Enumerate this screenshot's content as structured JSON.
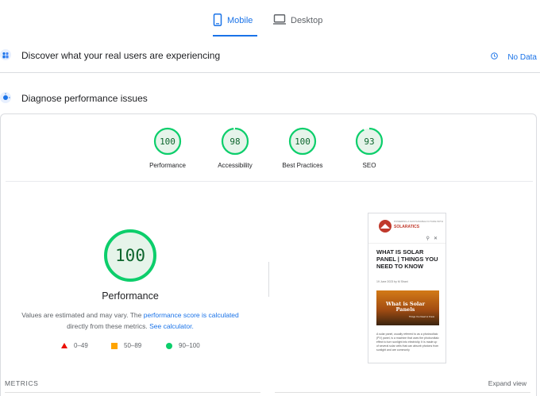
{
  "tabs": {
    "mobile": "Mobile",
    "desktop": "Desktop",
    "active": "mobile",
    "active_color": "#1a73e8"
  },
  "discover": {
    "title": "Discover what your real users are experiencing",
    "no_data": "No Data",
    "icon": "people-group-icon"
  },
  "diagnose": {
    "title": "Diagnose performance issues",
    "icon": "lighthouse-icon"
  },
  "categories": [
    {
      "label": "Performance",
      "score": "100",
      "value": 100
    },
    {
      "label": "Accessibility",
      "score": "98",
      "value": 98
    },
    {
      "label": "Best Practices",
      "score": "100",
      "value": 100
    },
    {
      "label": "SEO",
      "score": "93",
      "value": 93
    }
  ],
  "main": {
    "score": "100",
    "title": "Performance",
    "note_prefix": "Values are estimated and may vary. The ",
    "note_link1": "performance score is calculated",
    "note_middle": "directly from these metrics. ",
    "note_link2": "See calculator."
  },
  "legend": [
    {
      "range": "0–49",
      "color": "#eb0f00",
      "shape": "triangle"
    },
    {
      "range": "50–89",
      "color": "#ffa400",
      "shape": "square"
    },
    {
      "range": "90–100",
      "color": "#0cce6b",
      "shape": "circle"
    }
  ],
  "thumbnail": {
    "brand": "SOLARATICS",
    "tagline": "POWERING A SUSTAINABLE FUTURE WITH",
    "title": "WHAT IS SOLAR PANEL | THINGS YOU NEED TO KNOW",
    "date": "19 June 2023 by M Shani",
    "image_text": "What is Solar Panels",
    "image_subtext": "Things You Need to Know",
    "body": "A solar panel, usually referred to as a photovoltaic (PV) panel, is a machine that uses the photovoltaic effect to turn sunlight into electricity. It is made up of several solar cells that can absorb photons from sunlight and are commonly"
  },
  "footer": {
    "metrics": "METRICS",
    "expand": "Expand view"
  },
  "colors": {
    "pass": "#0cce6b",
    "pass_text": "#0d652d",
    "pass_fill": "#e6f4ea",
    "link": "#1a73e8"
  }
}
